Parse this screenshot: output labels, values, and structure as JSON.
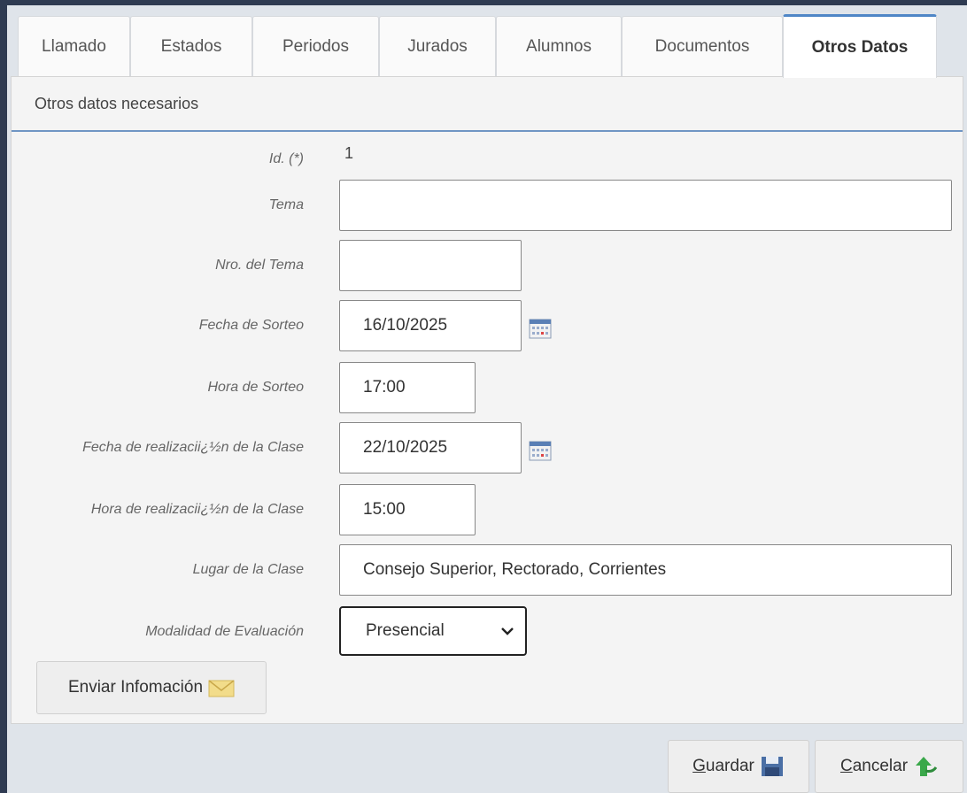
{
  "tabs": [
    {
      "label": "Llamado"
    },
    {
      "label": "Estados"
    },
    {
      "label": "Periodos"
    },
    {
      "label": "Jurados"
    },
    {
      "label": "Alumnos"
    },
    {
      "label": "Documentos"
    },
    {
      "label": "Otros Datos",
      "active": true
    }
  ],
  "panel": {
    "title": "Otros datos necesarios"
  },
  "form": {
    "id": {
      "label": "Id. (*)",
      "value": "1"
    },
    "tema": {
      "label": "Tema",
      "value": ""
    },
    "nro_tema": {
      "label": "Nro. del Tema",
      "value": ""
    },
    "fecha_sorteo": {
      "label": "Fecha de Sorteo",
      "value": "16/10/2025"
    },
    "hora_sorteo": {
      "label": "Hora de Sorteo",
      "value": "17:00"
    },
    "fecha_clase": {
      "label": "Fecha de realizacii¿½n de la Clase",
      "value": "22/10/2025"
    },
    "hora_clase": {
      "label": "Hora de realizacii¿½n de la Clase",
      "value": "15:00"
    },
    "lugar_clase": {
      "label": "Lugar de la Clase",
      "value": "Consejo Superior,  Rectorado, Corrientes"
    },
    "modalidad": {
      "label": "Modalidad de Evaluación",
      "value": "Presencial"
    }
  },
  "buttons": {
    "enviar": "Enviar Infomación",
    "guardar_first": "G",
    "guardar_rest": "uardar",
    "cancelar_first": "C",
    "cancelar_rest": "ancelar"
  },
  "icons": {
    "calendar": "calendar-icon",
    "envelope": "envelope-icon",
    "save": "floppy-disk-icon",
    "cancel": "green-arrow-icon"
  },
  "colors": {
    "accent": "#4f86c6",
    "save_icon": "#4a6fa5",
    "cancel_icon": "#3aa84a",
    "envelope": "#e8c860"
  }
}
